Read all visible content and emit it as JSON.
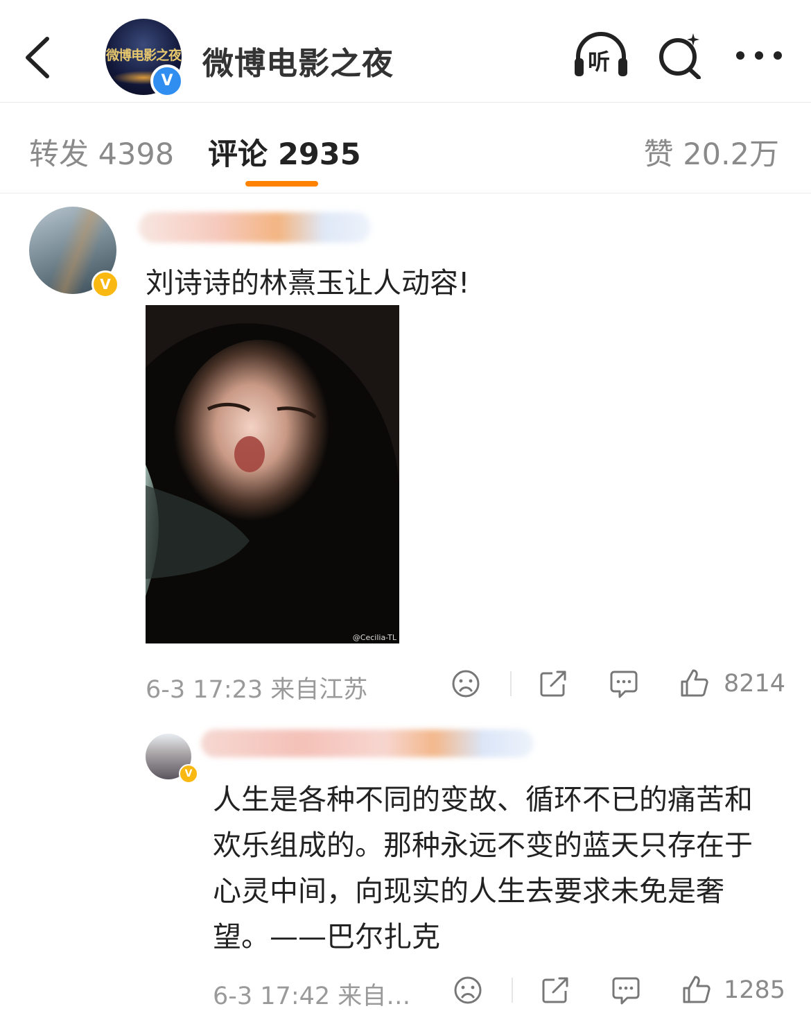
{
  "header": {
    "title": "微博电影之夜",
    "avatar_logo": "微博电影之夜",
    "icons": [
      "back-icon",
      "listen-icon",
      "search-icon",
      "more-icon"
    ],
    "listen_label": "听",
    "verified": "V"
  },
  "tabs": {
    "repost": "转发 4398",
    "comment": "评论 2935",
    "likes": "赞 20.2万",
    "active": "comment",
    "accent": "#ff8200"
  },
  "comments": [
    {
      "badge": "V",
      "text": "刘诗诗的林熹玉让人动容!",
      "image_watermark": "@Cecilia-TL",
      "meta": "6-3 17:23  来自江苏",
      "likes": "8214",
      "replies": [
        {
          "badge": "V",
          "text": "人生是各种不同的变故、循环不已的痛苦和欢乐组成的。那种永远不变的蓝天只存在于心灵中间，向现实的人生去要求未免是奢望。——巴尔扎克",
          "meta": "6-3 17:42  来自…",
          "likes": "1285"
        }
      ]
    }
  ],
  "colors": {
    "verified_blue": "#2f8ef0",
    "vip_gold": "#f9b812",
    "muted": "#9a9a9a"
  }
}
